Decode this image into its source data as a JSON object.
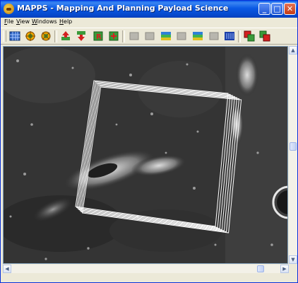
{
  "window": {
    "title": "MAPPS - Mapping And Planning Payload Science",
    "minimize_label": "_",
    "maximize_label": "□",
    "close_label": "✕"
  },
  "menu": {
    "items": [
      {
        "mnemonic": "F",
        "rest": "ile"
      },
      {
        "mnemonic": "V",
        "rest": "iew"
      },
      {
        "mnemonic": "W",
        "rest": "indows"
      },
      {
        "mnemonic": "H",
        "rest": "elp"
      }
    ]
  },
  "toolbar": {
    "tools": [
      {
        "icon": "grid-map-icon",
        "enabled": true
      },
      {
        "icon": "sun-target-icon",
        "enabled": true
      },
      {
        "icon": "orbit-target-icon",
        "enabled": true
      },
      {
        "icon": "arrow-up-icon",
        "enabled": true
      },
      {
        "icon": "arrow-down-icon",
        "enabled": true
      },
      {
        "icon": "r-marker-icon",
        "enabled": true
      },
      {
        "icon": "add-marker-icon",
        "enabled": true
      },
      {
        "icon": "disabled-tool-1-icon",
        "enabled": false
      },
      {
        "icon": "disabled-tool-2-icon",
        "enabled": false
      },
      {
        "icon": "color-layer-1-icon",
        "enabled": true
      },
      {
        "icon": "disabled-tool-3-icon",
        "enabled": false
      },
      {
        "icon": "color-layer-2-icon",
        "enabled": true
      },
      {
        "icon": "disabled-tool-4-icon",
        "enabled": false
      },
      {
        "icon": "bar-chart-icon",
        "enabled": true
      },
      {
        "icon": "stack-layers-red-icon",
        "enabled": true
      },
      {
        "icon": "stack-layers-green-icon",
        "enabled": true
      }
    ]
  },
  "map": {
    "description_icon": "lunar-surface-image",
    "footprint_count": 7
  },
  "colors": {
    "titlebar": "#0a59e4",
    "footprint": "#ffffff",
    "surface": "#1e1e1e"
  }
}
